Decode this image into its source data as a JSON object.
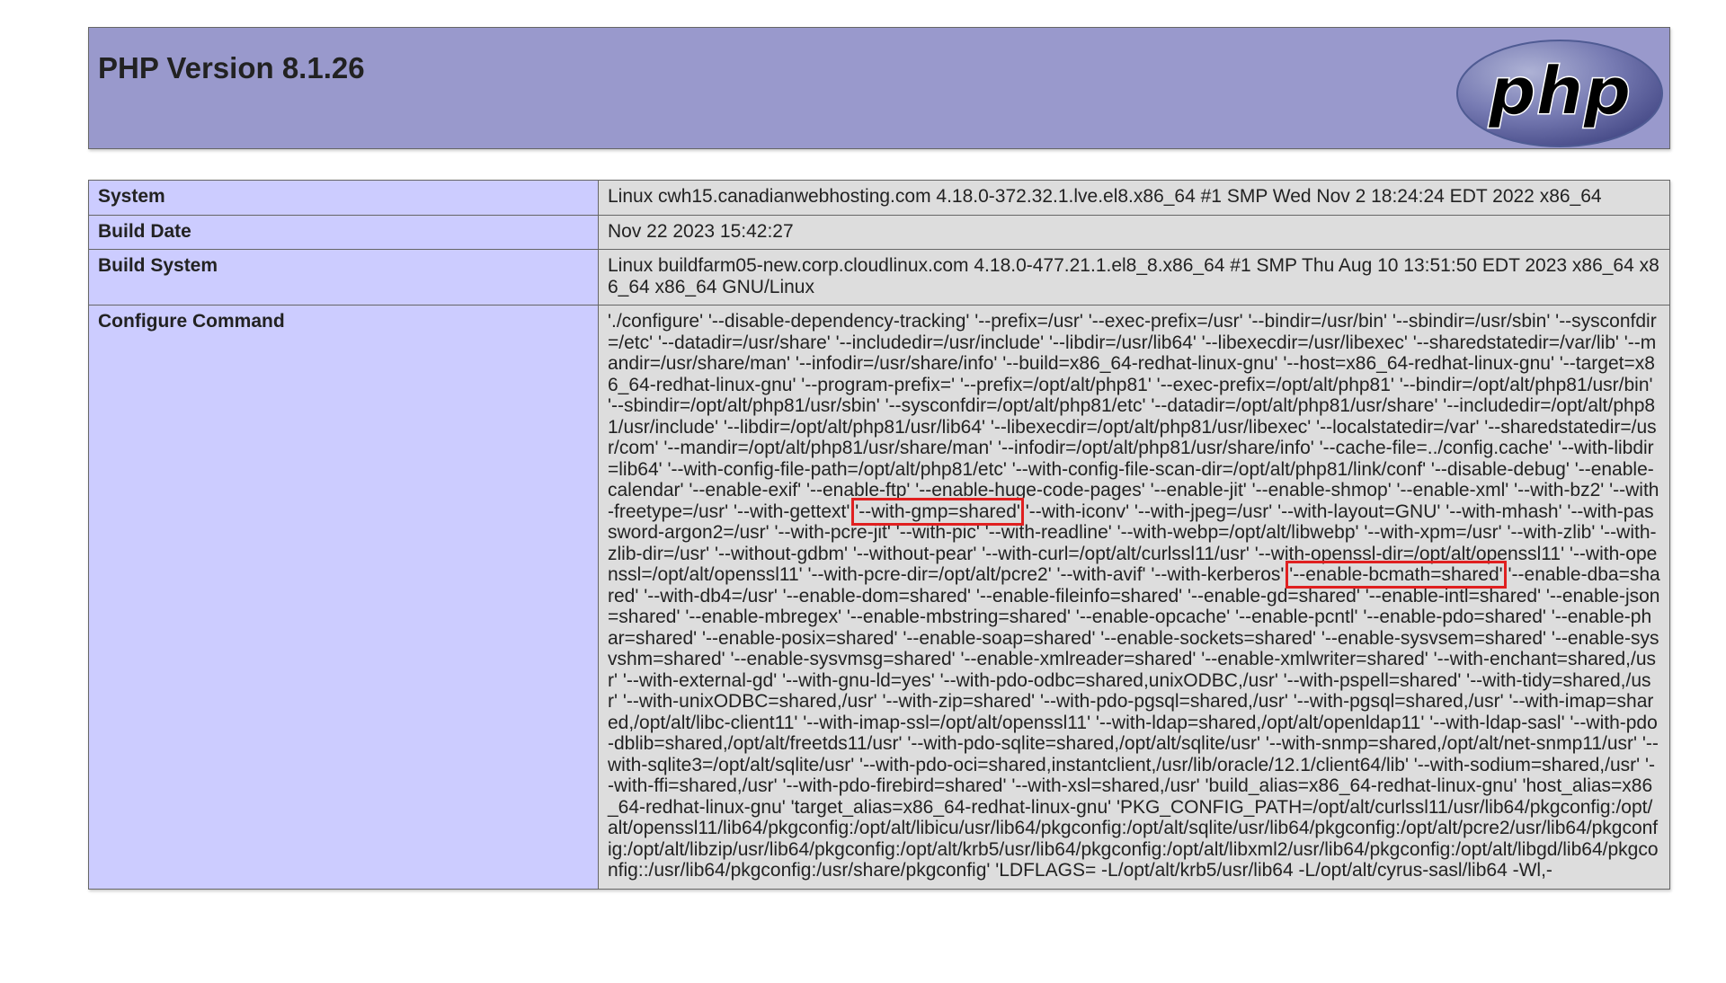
{
  "header": {
    "title": "PHP Version 8.1.26",
    "logo_text": "php",
    "colors": {
      "header_bg": "#9999cc",
      "label_bg": "#ccccff",
      "value_bg": "#dddddd",
      "highlight": "#e02020"
    }
  },
  "rows": {
    "system": {
      "label": "System",
      "value": "Linux cwh15.canadianwebhosting.com 4.18.0-372.32.1.lve.el8.x86_64 #1 SMP Wed Nov 2 18:24:24 EDT 2022 x86_64"
    },
    "build_date": {
      "label": "Build Date",
      "value": "Nov 22 2023 15:42:27"
    },
    "build_system": {
      "label": "Build System",
      "value": "Linux buildfarm05-new.corp.cloudlinux.com 4.18.0-477.21.1.el8_8.x86_64 #1 SMP Thu Aug 10 13:51:50 EDT 2023 x86_64 x86_64 x86_64 GNU/Linux"
    },
    "configure": {
      "label": "Configure Command",
      "value_part1": "'./configure' '--disable-dependency-tracking' '--prefix=/usr' '--exec-prefix=/usr' '--bindir=/usr/bin' '--sbindir=/usr/sbin' '--sysconfdir=/etc' '--datadir=/usr/share' '--includedir=/usr/include' '--libdir=/usr/lib64' '--libexecdir=/usr/libexec' '--sharedstatedir=/var/lib' '--mandir=/usr/share/man' '--infodir=/usr/share/info' '--build=x86_64-redhat-linux-gnu' '--host=x86_64-redhat-linux-gnu' '--target=x86_64-redhat-linux-gnu' '--program-prefix=' '--prefix=/opt/alt/php81' '--exec-prefix=/opt/alt/php81' '--bindir=/opt/alt/php81/usr/bin' '--sbindir=/opt/alt/php81/usr/sbin' '--sysconfdir=/opt/alt/php81/etc' '--datadir=/opt/alt/php81/usr/share' '--includedir=/opt/alt/php81/usr/include' '--libdir=/opt/alt/php81/usr/lib64' '--libexecdir=/opt/alt/php81/usr/libexec' '--localstatedir=/var' '--sharedstatedir=/usr/com' '--mandir=/opt/alt/php81/usr/share/man' '--infodir=/opt/alt/php81/usr/share/info' '--cache-file=../config.cache' '--with-libdir=lib64' '--with-config-file-path=/opt/alt/php81/etc' '--with-config-file-scan-dir=/opt/alt/php81/link/conf' '--disable-debug' '--enable-calendar' '--enable-exif' '--enable-ftp' '--enable-huge-code-pages' '--enable-jit' '--enable-shmop' '--enable-xml' '--with-bz2' '--with-freetype=/usr' '--with-gettext' ",
      "highlight1": "'--with-gmp=shared'",
      "value_part2": " '--with-iconv' '--with-jpeg=/usr' '--with-layout=GNU' '--with-mhash' '--with-password-argon2=/usr' '--with-pcre-jit' '--with-pic' '--with-readline' '--with-webp=/opt/alt/libwebp' '--with-xpm=/usr' '--with-zlib' '--with-zlib-dir=/usr' '--without-gdbm' '--without-pear' '--with-curl=/opt/alt/curlssl11/usr' '--with-openssl-dir=/opt/alt/openssl11' '--with-openssl=/opt/alt/openssl11' '--with-pcre-dir=/opt/alt/pcre2' '--with-avif' '--with-kerberos' ",
      "highlight2": "'--enable-bcmath=shared'",
      "value_part3": " '--enable-dba=shared' '--with-db4=/usr' '--enable-dom=shared' '--enable-fileinfo=shared' '--enable-gd=shared' '--enable-intl=shared' '--enable-json=shared' '--enable-mbregex' '--enable-mbstring=shared' '--enable-opcache' '--enable-pcntl' '--enable-pdo=shared' '--enable-phar=shared' '--enable-posix=shared' '--enable-soap=shared' '--enable-sockets=shared' '--enable-sysvsem=shared' '--enable-sysvshm=shared' '--enable-sysvmsg=shared' '--enable-xmlreader=shared' '--enable-xmlwriter=shared' '--with-enchant=shared,/usr' '--with-external-gd' '--with-gnu-ld=yes' '--with-pdo-odbc=shared,unixODBC,/usr' '--with-pspell=shared' '--with-tidy=shared,/usr' '--with-unixODBC=shared,/usr' '--with-zip=shared' '--with-pdo-pgsql=shared,/usr' '--with-pgsql=shared,/usr' '--with-imap=shared,/opt/alt/libc-client11' '--with-imap-ssl=/opt/alt/openssl11' '--with-ldap=shared,/opt/alt/openldap11' '--with-ldap-sasl' '--with-pdo-dblib=shared,/opt/alt/freetds11/usr' '--with-pdo-sqlite=shared,/opt/alt/sqlite/usr' '--with-snmp=shared,/opt/alt/net-snmp11/usr' '--with-sqlite3=/opt/alt/sqlite/usr' '--with-pdo-oci=shared,instantclient,/usr/lib/oracle/12.1/client64/lib' '--with-sodium=shared,/usr' '--with-ffi=shared,/usr' '--with-pdo-firebird=shared' '--with-xsl=shared,/usr' 'build_alias=x86_64-redhat-linux-gnu' 'host_alias=x86_64-redhat-linux-gnu' 'target_alias=x86_64-redhat-linux-gnu' 'PKG_CONFIG_PATH=/opt/alt/curlssl11/usr/lib64/pkgconfig:/opt/alt/openssl11/lib64/pkgconfig:/opt/alt/libicu/usr/lib64/pkgconfig:/opt/alt/sqlite/usr/lib64/pkgconfig:/opt/alt/pcre2/usr/lib64/pkgconfig:/opt/alt/libzip/usr/lib64/pkgconfig:/opt/alt/krb5/usr/lib64/pkgconfig:/opt/alt/libxml2/usr/lib64/pkgconfig:/opt/alt/libgd/lib64/pkgconfig::/usr/lib64/pkgconfig:/usr/share/pkgconfig' 'LDFLAGS= -L/opt/alt/krb5/usr/lib64 -L/opt/alt/cyrus-sasl/lib64 -Wl,-"
    }
  }
}
